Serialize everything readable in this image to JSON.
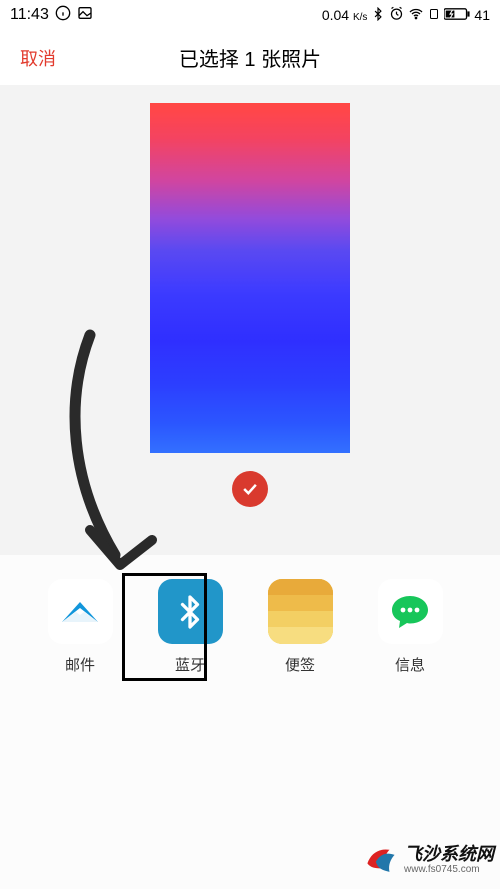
{
  "status": {
    "time": "11:43",
    "speed_value": "0.04",
    "speed_unit": "K/s",
    "battery": "41"
  },
  "header": {
    "cancel": "取消",
    "title": "已选择 1 张照片"
  },
  "share": {
    "items": [
      {
        "label": "邮件"
      },
      {
        "label": "蓝牙"
      },
      {
        "label": "便签"
      },
      {
        "label": "信息"
      }
    ]
  },
  "watermark": {
    "title": "飞沙系统网",
    "sub": "www.fs0745.com"
  }
}
